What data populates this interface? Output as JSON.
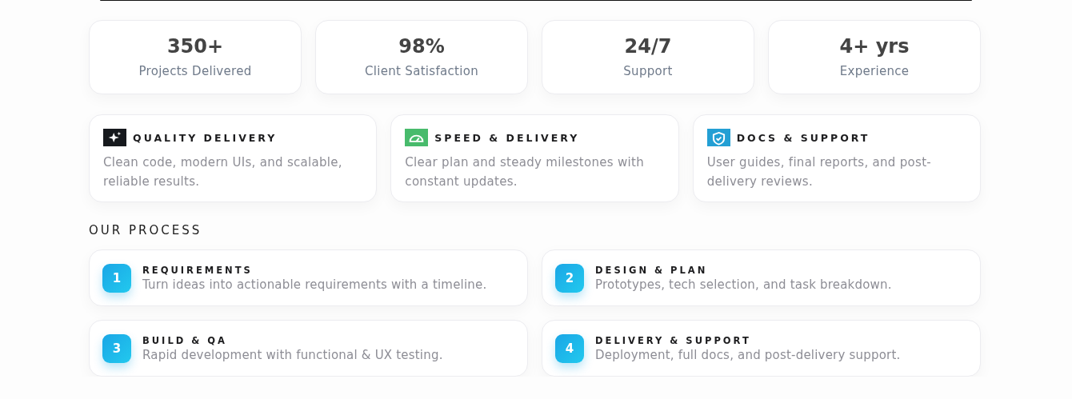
{
  "stats": [
    {
      "value": "350+",
      "label": "Projects Delivered"
    },
    {
      "value": "98%",
      "label": "Client Satisfaction"
    },
    {
      "value": "24/7",
      "label": "Support"
    },
    {
      "value": "4+ yrs",
      "label": "Experience"
    }
  ],
  "features": [
    {
      "kind": "sparkle",
      "color": "#16191d",
      "title": "QUALITY DELIVERY",
      "text": "Clean code, modern UIs, and scalable, reliable results."
    },
    {
      "kind": "gauge",
      "color": "#48bb6c",
      "title": "SPEED & DELIVERY",
      "text": "Clear plan and steady milestones with constant updates."
    },
    {
      "kind": "shield",
      "color": "#239fd4",
      "title": "DOCS & SUPPORT",
      "text": "User guides, final reports, and post-delivery reviews."
    }
  ],
  "process": {
    "heading": "OUR PROCESS",
    "steps": [
      {
        "number": "1",
        "title": "REQUIREMENTS",
        "text": "Turn ideas into actionable requirements with a timeline."
      },
      {
        "number": "2",
        "title": "DESIGN & PLAN",
        "text": "Prototypes, tech selection, and task breakdown."
      },
      {
        "number": "3",
        "title": "BUILD & QA",
        "text": "Rapid development with functional & UX testing."
      },
      {
        "number": "4",
        "title": "DELIVERY & SUPPORT",
        "text": "Deployment, full docs, and post-delivery support."
      }
    ]
  }
}
